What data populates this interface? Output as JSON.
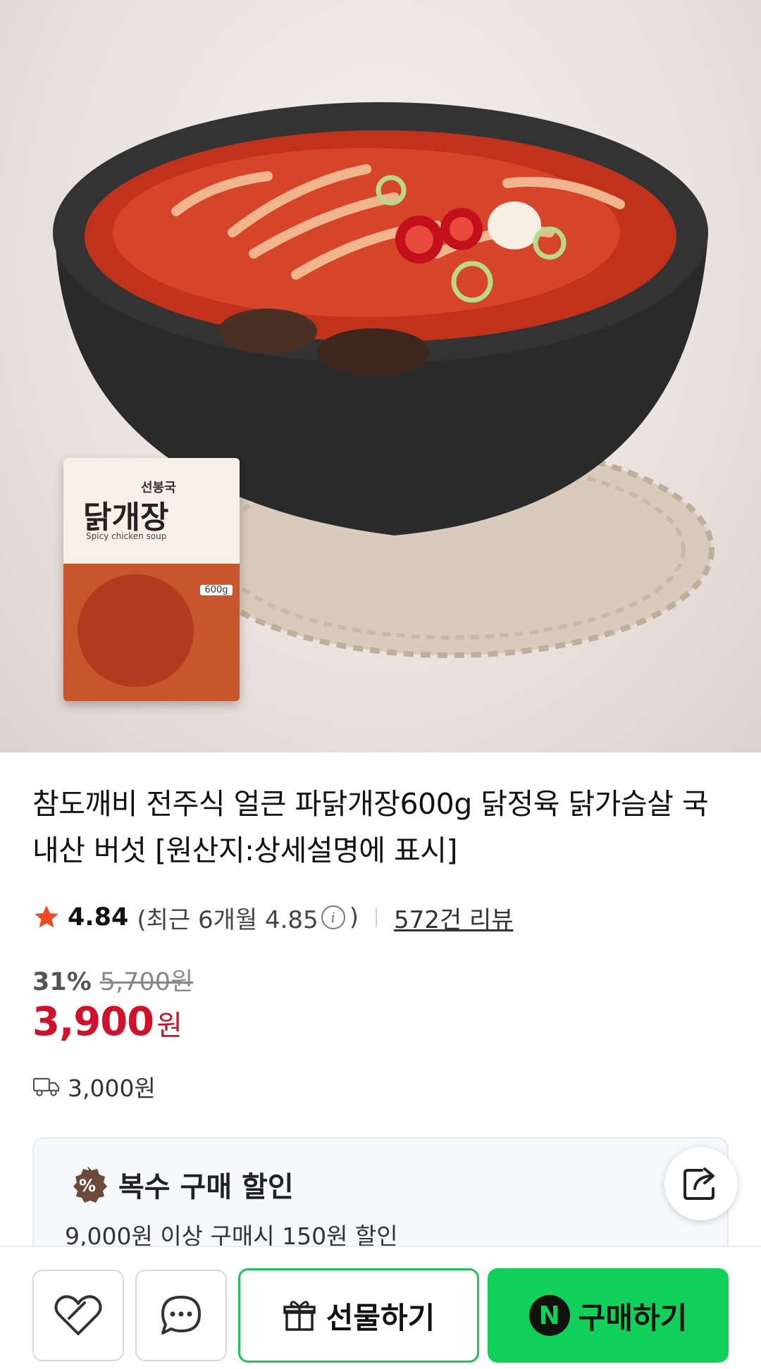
{
  "product": {
    "title": "참도깨비 전주식 얼큰 파닭개장600g 닭정육 닭가슴살 국내산 버섯 [원산지:상세설명에 표시]",
    "package": {
      "brand_small": "선봉국",
      "name": "닭개장",
      "english": "Spicy chicken soup",
      "weight": "600g"
    }
  },
  "rating": {
    "score": "4.84",
    "recent_prefix": "(최근 6개월 4.85",
    "recent_suffix": ")",
    "reviews": "572건 리뷰"
  },
  "price": {
    "discount": "31%",
    "original": "5,700원",
    "sale": "3,900",
    "currency": "원"
  },
  "shipping": {
    "fee": "3,000원",
    "icon": "truck-icon"
  },
  "multi_discount": {
    "title": "복수 구매 할인",
    "description": "9,000원 이상 구매시 150원 할인",
    "icon": "percent-badge-icon"
  },
  "bottom_bar": {
    "gift_label": "선물하기",
    "buy_label": "구매하기",
    "buy_badge": "N"
  },
  "colors": {
    "sale_red": "#d0112b",
    "buy_green": "#12d15a",
    "gift_border": "#1fc35a",
    "star": "#f04a23",
    "badge_brown": "#6b4a3a"
  }
}
